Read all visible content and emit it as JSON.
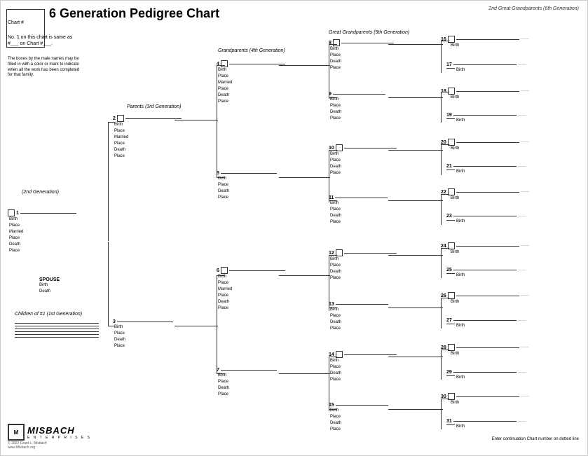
{
  "title": "6 Generation Pedigree Chart",
  "chart_number_label": "Chart #",
  "note1": "No. 1 on this chart is same as #___ on Chart #___.",
  "note2": "The boxes by the male names may be filled in with a color or mark to indicate when all the work has been completed for that family.",
  "gen_labels": {
    "gen2": "(2nd Generation)",
    "gen3": "Parents (3rd Generation)",
    "gen4": "Grandparents (4th Generation)",
    "gen5": "Great Grandparents (5th Generation)",
    "gen6": "2nd Great Grandparents (6th Generation)"
  },
  "persons": {
    "p1": {
      "num": "1",
      "fields": [
        "Birth",
        "Place",
        "Married",
        "Place",
        "Death",
        "Place"
      ]
    },
    "p2": {
      "num": "2",
      "fields": [
        "Birth",
        "Place",
        "Married",
        "Place",
        "Death",
        "Place"
      ]
    },
    "p3": {
      "num": "3",
      "fields": [
        "Birth",
        "Place",
        "Death",
        "Place"
      ]
    },
    "p4": {
      "num": "4",
      "fields": [
        "Birth",
        "Place",
        "Married",
        "Place",
        "Death",
        "Place"
      ]
    },
    "p5": {
      "num": "5",
      "fields": [
        "Birth",
        "Place",
        "Death",
        "Place"
      ]
    },
    "p6": {
      "num": "6",
      "fields": [
        "Birth",
        "Place",
        "Married",
        "Place",
        "Death",
        "Place"
      ]
    },
    "p7": {
      "num": "7",
      "fields": [
        "Birth",
        "Place",
        "Death",
        "Place"
      ]
    },
    "p8": {
      "num": "8",
      "fields": [
        "Birth",
        "Place",
        "Death",
        "Place"
      ]
    },
    "p9": {
      "num": "9",
      "fields": [
        "Birth",
        "Place",
        "Death",
        "Place"
      ]
    },
    "p10": {
      "num": "10",
      "fields": [
        "Birth",
        "Place",
        "Death",
        "Place"
      ]
    },
    "p11": {
      "num": "11",
      "fields": [
        "Birth",
        "Place",
        "Death",
        "Place"
      ]
    },
    "p12": {
      "num": "12",
      "fields": [
        "Birth",
        "Place",
        "Death",
        "Place"
      ]
    },
    "p13": {
      "num": "13",
      "fields": [
        "Birth",
        "Place",
        "Death",
        "Place"
      ]
    },
    "p14": {
      "num": "14",
      "fields": [
        "Birth",
        "Place",
        "Death",
        "Place"
      ]
    },
    "p15": {
      "num": "15",
      "fields": [
        "Birth",
        "Place",
        "Death",
        "Place"
      ]
    }
  },
  "gen6_persons": [
    {
      "num": "16",
      "field": "Birth"
    },
    {
      "num": "17",
      "field": "Birth"
    },
    {
      "num": "18",
      "field": "Birth"
    },
    {
      "num": "19",
      "field": "Birth"
    },
    {
      "num": "20",
      "field": "Birth"
    },
    {
      "num": "21",
      "field": "Birth"
    },
    {
      "num": "22",
      "field": "Birth"
    },
    {
      "num": "23",
      "field": "Birth"
    },
    {
      "num": "24",
      "field": "Birth"
    },
    {
      "num": "25",
      "field": "Birth"
    },
    {
      "num": "26",
      "field": "Birth"
    },
    {
      "num": "27",
      "field": "Birth"
    },
    {
      "num": "28",
      "field": "Birth"
    },
    {
      "num": "29",
      "field": "Birth"
    },
    {
      "num": "30",
      "field": "Birth"
    },
    {
      "num": "31",
      "field": "Birth"
    }
  ],
  "spouse_label": "SPOUSE",
  "spouse_fields": [
    "Birth",
    "Death"
  ],
  "children_label": "Children of #1 (1st Generation)",
  "footer_note": "Enter continuation Chart number on dotted line",
  "logo": "MISBACH",
  "logo_sub": "E N T E R P R I S E S",
  "copyright": "© 2002 Grant L. Misbach\nwww.Misbach.org"
}
